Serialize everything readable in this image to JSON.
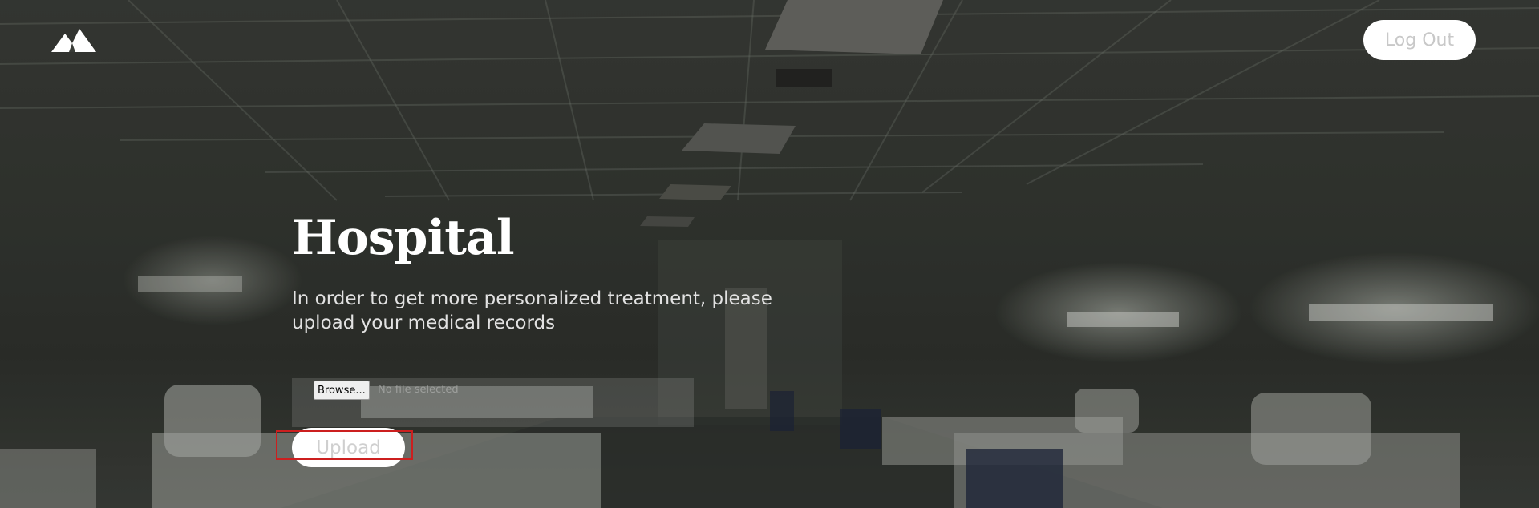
{
  "header": {
    "logo_icon": "mountain-logo-icon",
    "logout_label": "Log Out"
  },
  "hero": {
    "title": "Hospital",
    "subtitle": "In order to get more personalized treatment, please upload your medical records"
  },
  "upload_form": {
    "browse_label": "Browse...",
    "file_status": "No file selected",
    "upload_label": "Upload"
  },
  "colors": {
    "button_bg": "#ffffff",
    "button_text": "#c8c8c8",
    "title_text": "#ffffff",
    "focus_outline": "#cc1f1f"
  }
}
